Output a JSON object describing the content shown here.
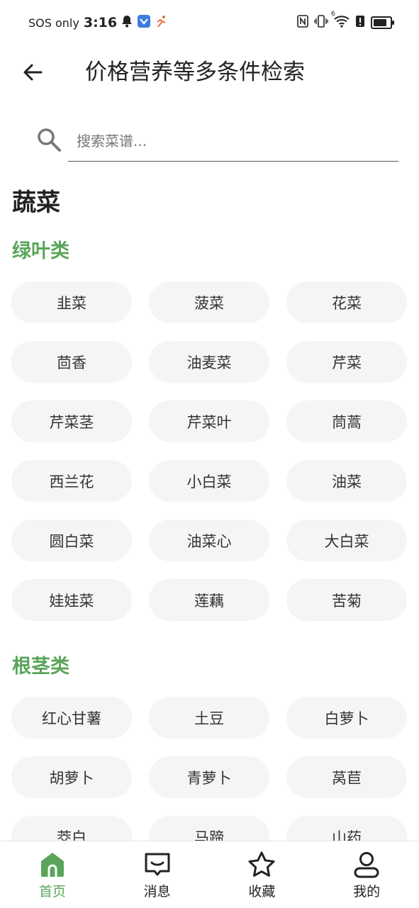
{
  "status_bar": {
    "carrier": "SOS only",
    "time": "3:16",
    "wifi_badge": "6"
  },
  "header": {
    "title": "价格营养等多条件检索"
  },
  "search": {
    "placeholder": "搜索菜谱..."
  },
  "category": {
    "title": "蔬菜",
    "groups": [
      {
        "title": "绿叶类",
        "items": [
          "韭菜",
          "菠菜",
          "花菜",
          "茴香",
          "油麦菜",
          "芹菜",
          "芹菜茎",
          "芹菜叶",
          "茼蒿",
          "西兰花",
          "小白菜",
          "油菜",
          "圆白菜",
          "油菜心",
          "大白菜",
          "娃娃菜",
          "莲藕",
          "苦菊"
        ]
      },
      {
        "title": "根茎类",
        "items": [
          "红心甘薯",
          "土豆",
          "白萝卜",
          "胡萝卜",
          "青萝卜",
          "莴苣",
          "茭白",
          "马蹄",
          "山药"
        ]
      }
    ]
  },
  "bottom_nav": [
    {
      "label": "首页",
      "icon": "home-icon",
      "active": true
    },
    {
      "label": "消息",
      "icon": "message-icon",
      "active": false
    },
    {
      "label": "收藏",
      "icon": "star-icon",
      "active": false
    },
    {
      "label": "我的",
      "icon": "person-icon",
      "active": false
    }
  ],
  "colors": {
    "accent": "#5aa55b",
    "chip_bg": "#f5f5f5",
    "text": "#222222"
  }
}
